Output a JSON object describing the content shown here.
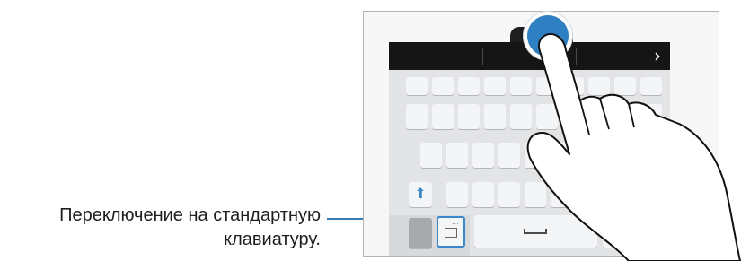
{
  "callout": {
    "text_line1": "Переключение на стандартную",
    "text_line2": "клавиатуру."
  },
  "prediction_bar": {
    "arrow_icon": "chevron-right-icon",
    "arrow_glyph": "›"
  },
  "keyboard": {
    "shift_icon": "shift-icon",
    "shift_glyph": "⬆",
    "mode_key_icon": "keyboard-mode-icon",
    "mode_key_dots": "···",
    "space_icon": "space-icon"
  },
  "colors": {
    "accent": "#3b88c9",
    "touch": "#2f80c2",
    "bar": "#151515",
    "keyboard_bg": "#e3e4e6",
    "key": "#f4f5f6"
  }
}
